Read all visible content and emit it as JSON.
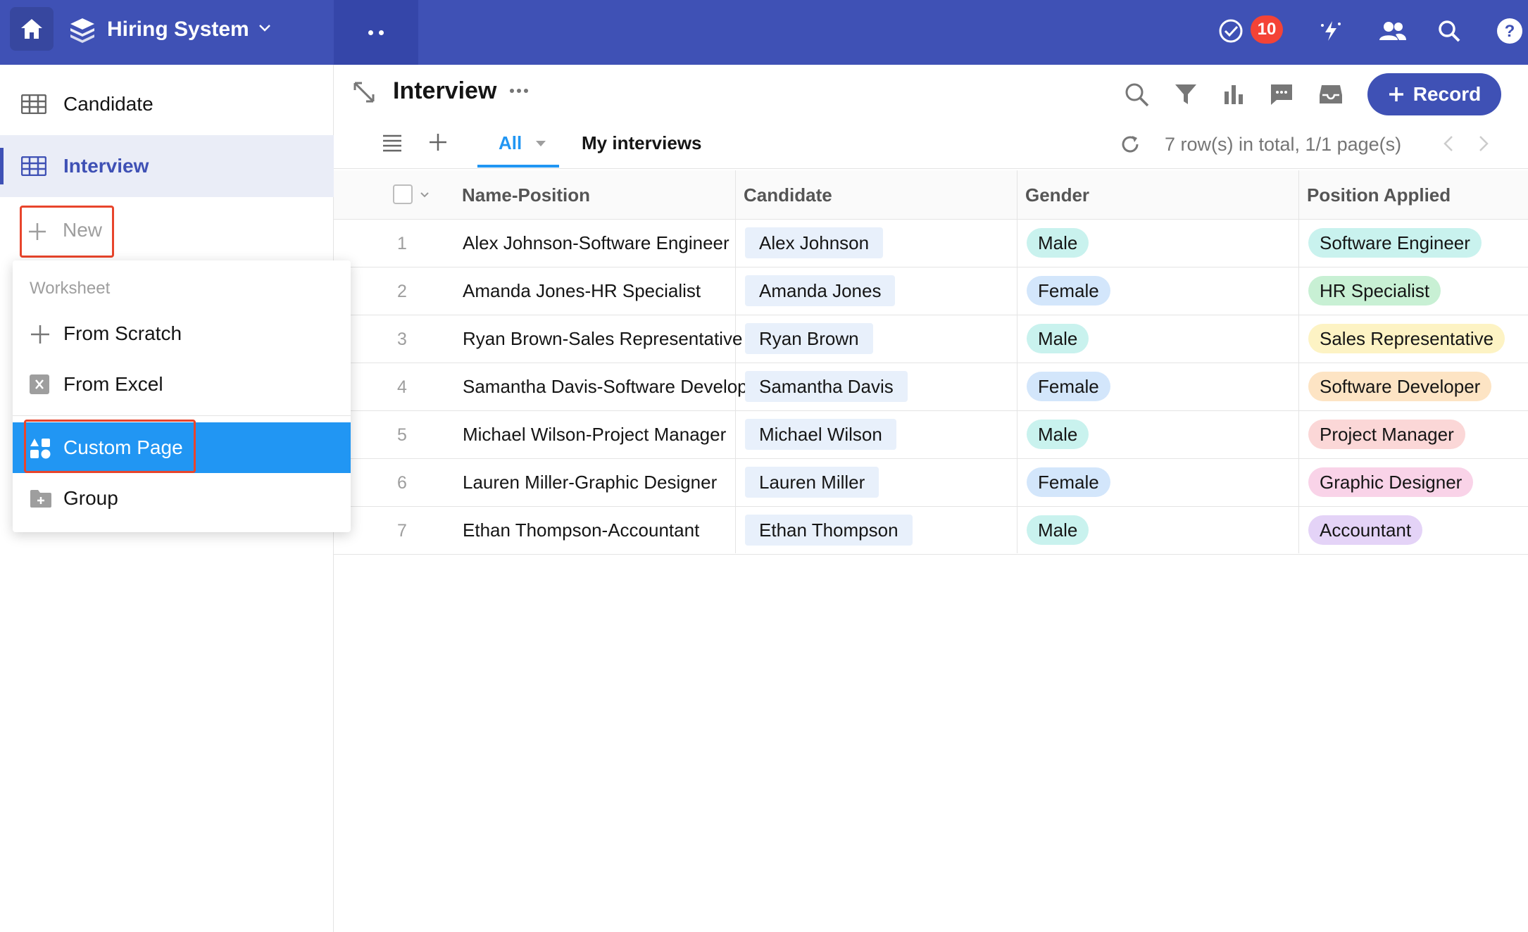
{
  "app": {
    "name": "Hiring System",
    "notifications": "10"
  },
  "sidebar": {
    "items": [
      {
        "label": "Candidate"
      },
      {
        "label": "Interview"
      }
    ],
    "new_label": "New"
  },
  "dropdown": {
    "section": "Worksheet",
    "items": [
      {
        "label": "From Scratch"
      },
      {
        "label": "From Excel"
      },
      {
        "label": "Custom Page"
      },
      {
        "label": "Group"
      }
    ]
  },
  "main": {
    "title": "Interview",
    "record_button": "Record",
    "views": {
      "all": "All",
      "mine": "My interviews"
    },
    "row_info": "7 row(s) in total, 1/1 page(s)"
  },
  "table": {
    "columns": [
      "Name-Position",
      "Candidate",
      "Gender",
      "Position Applied"
    ],
    "rows": [
      {
        "num": "1",
        "name_position": "Alex Johnson-Software Engineer",
        "candidate": "Alex Johnson",
        "gender": "Male",
        "position": "Software Engineer",
        "pos_color": "#c9f2ee"
      },
      {
        "num": "2",
        "name_position": "Amanda Jones-HR Specialist",
        "candidate": "Amanda Jones",
        "gender": "Female",
        "position": "HR Specialist",
        "pos_color": "#c8f0d4"
      },
      {
        "num": "3",
        "name_position": "Ryan Brown-Sales Representative",
        "candidate": "Ryan Brown",
        "gender": "Male",
        "position": "Sales Representative",
        "pos_color": "#fdf3c4"
      },
      {
        "num": "4",
        "name_position": "Samantha Davis-Software Developer",
        "candidate": "Samantha Davis",
        "gender": "Female",
        "position": "Software Developer",
        "pos_color": "#fde4c4"
      },
      {
        "num": "5",
        "name_position": "Michael Wilson-Project Manager",
        "candidate": "Michael Wilson",
        "gender": "Male",
        "position": "Project Manager",
        "pos_color": "#fbd7d7"
      },
      {
        "num": "6",
        "name_position": "Lauren Miller-Graphic Designer",
        "candidate": "Lauren Miller",
        "gender": "Female",
        "position": "Graphic Designer",
        "pos_color": "#f9d3e8"
      },
      {
        "num": "7",
        "name_position": "Ethan Thompson-Accountant",
        "candidate": "Ethan Thompson",
        "gender": "Male",
        "position": "Accountant",
        "pos_color": "#e4d3f7"
      }
    ]
  },
  "colors": {
    "brand": "#3f51b5",
    "accent_blue": "#2196f3",
    "male_chip": "#c9f2ee",
    "female_chip": "#d3e6fb",
    "highlight_red": "#e8452c",
    "badge_red": "#f44336"
  },
  "icons": [
    "home-icon",
    "app-logo-icon",
    "chevron-down-icon",
    "todo-check-icon",
    "magic-icon",
    "members-icon",
    "search-icon",
    "help-icon",
    "table-icon",
    "plus-icon",
    "excel-icon",
    "custom-page-icon",
    "folder-icon",
    "collapse-icon",
    "filter-icon",
    "chart-icon",
    "comment-icon",
    "inbox-icon",
    "menu-icon",
    "refresh-icon",
    "prev-page-icon",
    "next-page-icon"
  ]
}
